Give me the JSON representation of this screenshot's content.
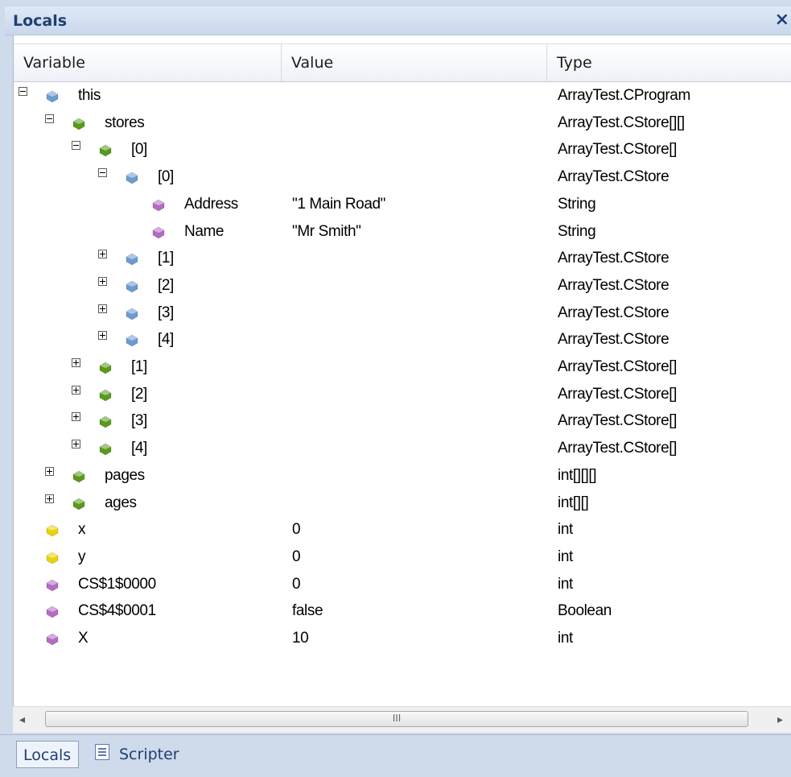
{
  "window": {
    "title": "Locals",
    "close_label": "×"
  },
  "columns": {
    "variable": "Variable",
    "value": "Value",
    "type": "Type"
  },
  "colors": {
    "blue_gem": "#6b9bd1",
    "green_gem": "#5a9a1a",
    "purple_gem": "#b46bc4",
    "yellow_gem": "#e8d400"
  },
  "rows": [
    {
      "name": "this",
      "value": "",
      "type": "ArrayTest.CProgram",
      "level": 0,
      "expander": "minus",
      "icon": "blue"
    },
    {
      "name": "stores",
      "value": "",
      "type": "ArrayTest.CStore[][]",
      "level": 1,
      "expander": "minus",
      "icon": "green"
    },
    {
      "name": "[0]",
      "value": "",
      "type": "ArrayTest.CStore[]",
      "level": 2,
      "expander": "minus",
      "icon": "green"
    },
    {
      "name": "[0]",
      "value": "",
      "type": "ArrayTest.CStore",
      "level": 3,
      "expander": "minus",
      "icon": "blue"
    },
    {
      "name": "Address",
      "value": "\"1 Main Road\"",
      "type": "String",
      "level": 4,
      "expander": "none",
      "icon": "purple"
    },
    {
      "name": "Name",
      "value": "\"Mr Smith\"",
      "type": "String",
      "level": 4,
      "expander": "none",
      "icon": "purple"
    },
    {
      "name": "[1]",
      "value": "",
      "type": "ArrayTest.CStore",
      "level": 3,
      "expander": "plus",
      "icon": "blue"
    },
    {
      "name": "[2]",
      "value": "",
      "type": "ArrayTest.CStore",
      "level": 3,
      "expander": "plus",
      "icon": "blue"
    },
    {
      "name": "[3]",
      "value": "",
      "type": "ArrayTest.CStore",
      "level": 3,
      "expander": "plus",
      "icon": "blue"
    },
    {
      "name": "[4]",
      "value": "",
      "type": "ArrayTest.CStore",
      "level": 3,
      "expander": "plus",
      "icon": "blue"
    },
    {
      "name": "[1]",
      "value": "",
      "type": "ArrayTest.CStore[]",
      "level": 2,
      "expander": "plus",
      "icon": "green"
    },
    {
      "name": "[2]",
      "value": "",
      "type": "ArrayTest.CStore[]",
      "level": 2,
      "expander": "plus",
      "icon": "green"
    },
    {
      "name": "[3]",
      "value": "",
      "type": "ArrayTest.CStore[]",
      "level": 2,
      "expander": "plus",
      "icon": "green"
    },
    {
      "name": "[4]",
      "value": "",
      "type": "ArrayTest.CStore[]",
      "level": 2,
      "expander": "plus",
      "icon": "green"
    },
    {
      "name": "pages",
      "value": "",
      "type": "int[][][]",
      "level": 1,
      "expander": "plus",
      "icon": "green"
    },
    {
      "name": "ages",
      "value": "",
      "type": "int[][]",
      "level": 1,
      "expander": "plus",
      "icon": "green"
    },
    {
      "name": "x",
      "value": "0",
      "type": "int",
      "level": 0,
      "expander": "none",
      "icon": "yellow"
    },
    {
      "name": "y",
      "value": "0",
      "type": "int",
      "level": 0,
      "expander": "none",
      "icon": "yellow"
    },
    {
      "name": "CS$1$0000",
      "value": "0",
      "type": "int",
      "level": 0,
      "expander": "none",
      "icon": "purple"
    },
    {
      "name": "CS$4$0001",
      "value": "false",
      "type": "Boolean",
      "level": 0,
      "expander": "none",
      "icon": "purple"
    },
    {
      "name": "X",
      "value": "10",
      "type": "int",
      "level": 0,
      "expander": "none",
      "icon": "purple"
    }
  ],
  "scrollbar": {
    "left_arrow": "◂",
    "right_arrow": "▸",
    "grip": "III"
  },
  "tabs": [
    {
      "label": "Locals",
      "active": true
    },
    {
      "label": "Scripter",
      "active": false
    }
  ]
}
